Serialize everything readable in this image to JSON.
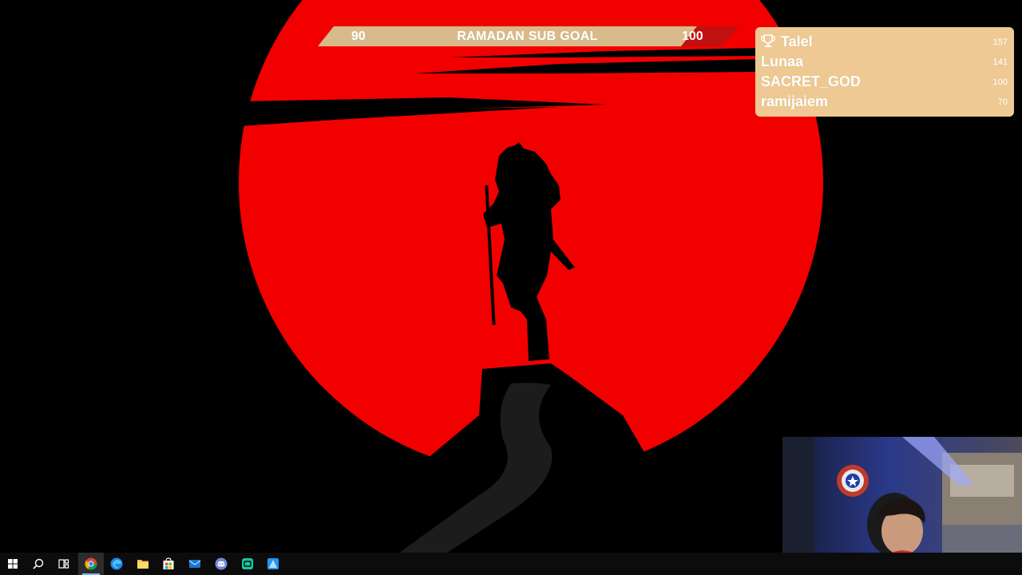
{
  "goal": {
    "current": "90",
    "title": "RAMADAN SUB GOAL",
    "target": "100",
    "progress_fraction": 0.9,
    "bar_color": "#d8b98a",
    "end_color": "#c01010"
  },
  "leaderboard": {
    "background": "#eec993",
    "entries": [
      {
        "name": "Talel",
        "score": "157"
      },
      {
        "name": "Lunaa",
        "score": "141"
      },
      {
        "name": "SACRET_GOD",
        "score": "100"
      },
      {
        "name": "ramijaiem",
        "score": "70"
      }
    ]
  },
  "wallpaper": {
    "moon_color": "#ff0000",
    "background_color": "#000000"
  },
  "taskbar": {
    "items": [
      {
        "icon": "windows-start-icon"
      },
      {
        "icon": "search-icon"
      },
      {
        "icon": "task-view-icon"
      },
      {
        "icon": "chrome-icon"
      },
      {
        "icon": "edge-icon"
      },
      {
        "icon": "file-explorer-icon"
      },
      {
        "icon": "microsoft-store-icon"
      },
      {
        "icon": "mail-icon"
      },
      {
        "icon": "discord-icon"
      },
      {
        "icon": "app-green-icon"
      },
      {
        "icon": "app-blue-icon"
      }
    ]
  }
}
